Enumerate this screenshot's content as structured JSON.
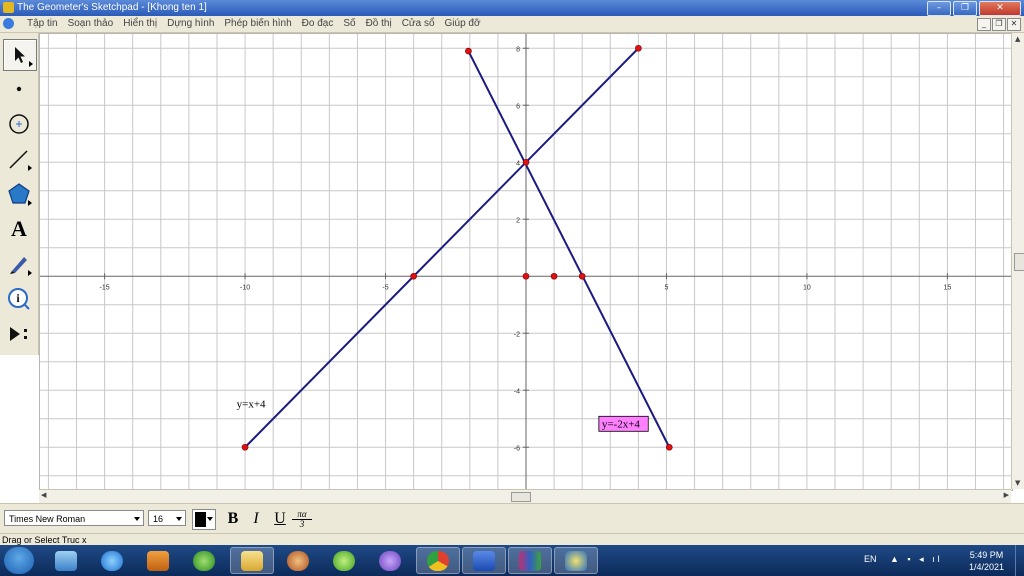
{
  "window": {
    "title": "The Geometer's Sketchpad - [Khong ten 1]",
    "minimize": "–",
    "restore": "❐",
    "close": "✕"
  },
  "menu": [
    "Tập tin",
    "Soạn thảo",
    "Hiển thị",
    "Dựng hình",
    "Phép biến hình",
    "Đo đạc",
    "Số",
    "Đồ thị",
    "Cửa sổ",
    "Giúp đỡ"
  ],
  "doc_buttons": [
    "_",
    "❐",
    "✕"
  ],
  "tools": [
    {
      "name": "arrow-select-tool",
      "icon": "arrow-icon"
    },
    {
      "name": "point-tool",
      "icon": "point-icon"
    },
    {
      "name": "compass-tool",
      "icon": "circle-icon"
    },
    {
      "name": "straightedge-tool",
      "icon": "segment-icon"
    },
    {
      "name": "polygon-tool",
      "icon": "pentagon-icon"
    },
    {
      "name": "text-tool",
      "icon": "text-A-icon",
      "label": "A"
    },
    {
      "name": "marker-tool",
      "icon": "pen-icon"
    },
    {
      "name": "information-tool",
      "icon": "info-icon",
      "label": "i"
    },
    {
      "name": "custom-tool",
      "icon": "play-custom-icon"
    }
  ],
  "chart_data": {
    "type": "line",
    "x_axis": {
      "min": -17.3,
      "max": 17.3,
      "ticks": [
        -15,
        -10,
        -5,
        5,
        10,
        15
      ]
    },
    "y_axis": {
      "min": -7.5,
      "max": 8.5,
      "ticks": [
        -6,
        -4,
        -2,
        2,
        4,
        6,
        8
      ]
    },
    "grid": true,
    "series": [
      {
        "name": "y=x+4",
        "color": "#1a1a80",
        "points": [
          [
            -10,
            -6
          ],
          [
            4,
            8
          ]
        ]
      },
      {
        "name": "y=-2x+4",
        "color": "#1a1a80",
        "points": [
          [
            -2.05,
            7.9
          ],
          [
            5.1,
            -6
          ]
        ]
      }
    ],
    "points": [
      [
        -10,
        -6
      ],
      [
        4,
        8
      ],
      [
        -4,
        0
      ],
      [
        0,
        4
      ],
      [
        -2.05,
        7.9
      ],
      [
        5.1,
        -6
      ],
      [
        0,
        0
      ],
      [
        1,
        0
      ],
      [
        2,
        0
      ]
    ],
    "point_color": "#e01010",
    "labels": [
      {
        "text": "y=x+4",
        "at": [
          -10.3,
          -4.6
        ],
        "highlight": false
      },
      {
        "text": "y=-2x+4",
        "at": [
          2.7,
          -5.3
        ],
        "highlight": true,
        "highlight_color": "#ff80ff"
      }
    ]
  },
  "format_bar": {
    "font": "Times New Roman",
    "size": "16",
    "bold": "B",
    "italic": "I",
    "underline": "U",
    "math_top": "πα",
    "math_bottom": "3"
  },
  "status": "Drag or Select Truc x",
  "taskbar": {
    "apps": [
      "windows-start",
      "control-panel",
      "internet-explorer",
      "media-player",
      "sketchpad",
      "file-explorer",
      "app-circle",
      "app-green",
      "viber",
      "chrome",
      "word",
      "winrar",
      "sketchpad-active"
    ],
    "lang": "EN",
    "time": "5:49 PM",
    "date": "1/4/2021"
  }
}
